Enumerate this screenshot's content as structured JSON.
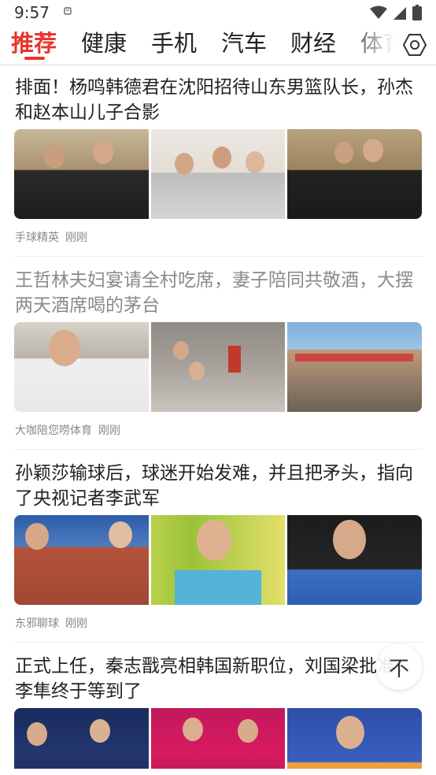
{
  "status": {
    "time": "9:57"
  },
  "tabs": [
    "推荐",
    "健康",
    "手机",
    "汽车",
    "财经",
    "体育"
  ],
  "articles": [
    {
      "title": "排面！杨鸣韩德君在沈阳招待山东男篮队长，孙杰和赵本山儿子合影",
      "source": "手球精英",
      "time": "刚刚",
      "read": false
    },
    {
      "title": "王哲林夫妇宴请全村吃席，妻子陪同共敬酒，大摆两天酒席喝的茅台",
      "source": "大咖陪您唠体育",
      "time": "刚刚",
      "read": true
    },
    {
      "title": "孙颖莎输球后，球迷开始发难，并且把矛头，指向了央视记者李武军",
      "source": "东邪聊球",
      "time": "刚刚",
      "read": false
    },
    {
      "title": "正式上任，秦志戬亮相韩国新职位，刘国梁批准，李隼终于等到了",
      "source": "",
      "time": "",
      "read": false
    }
  ],
  "scroll_top": {
    "label": "不"
  },
  "colors": {
    "accent": "#e8362c",
    "text": "#222222",
    "muted": "#888888"
  }
}
